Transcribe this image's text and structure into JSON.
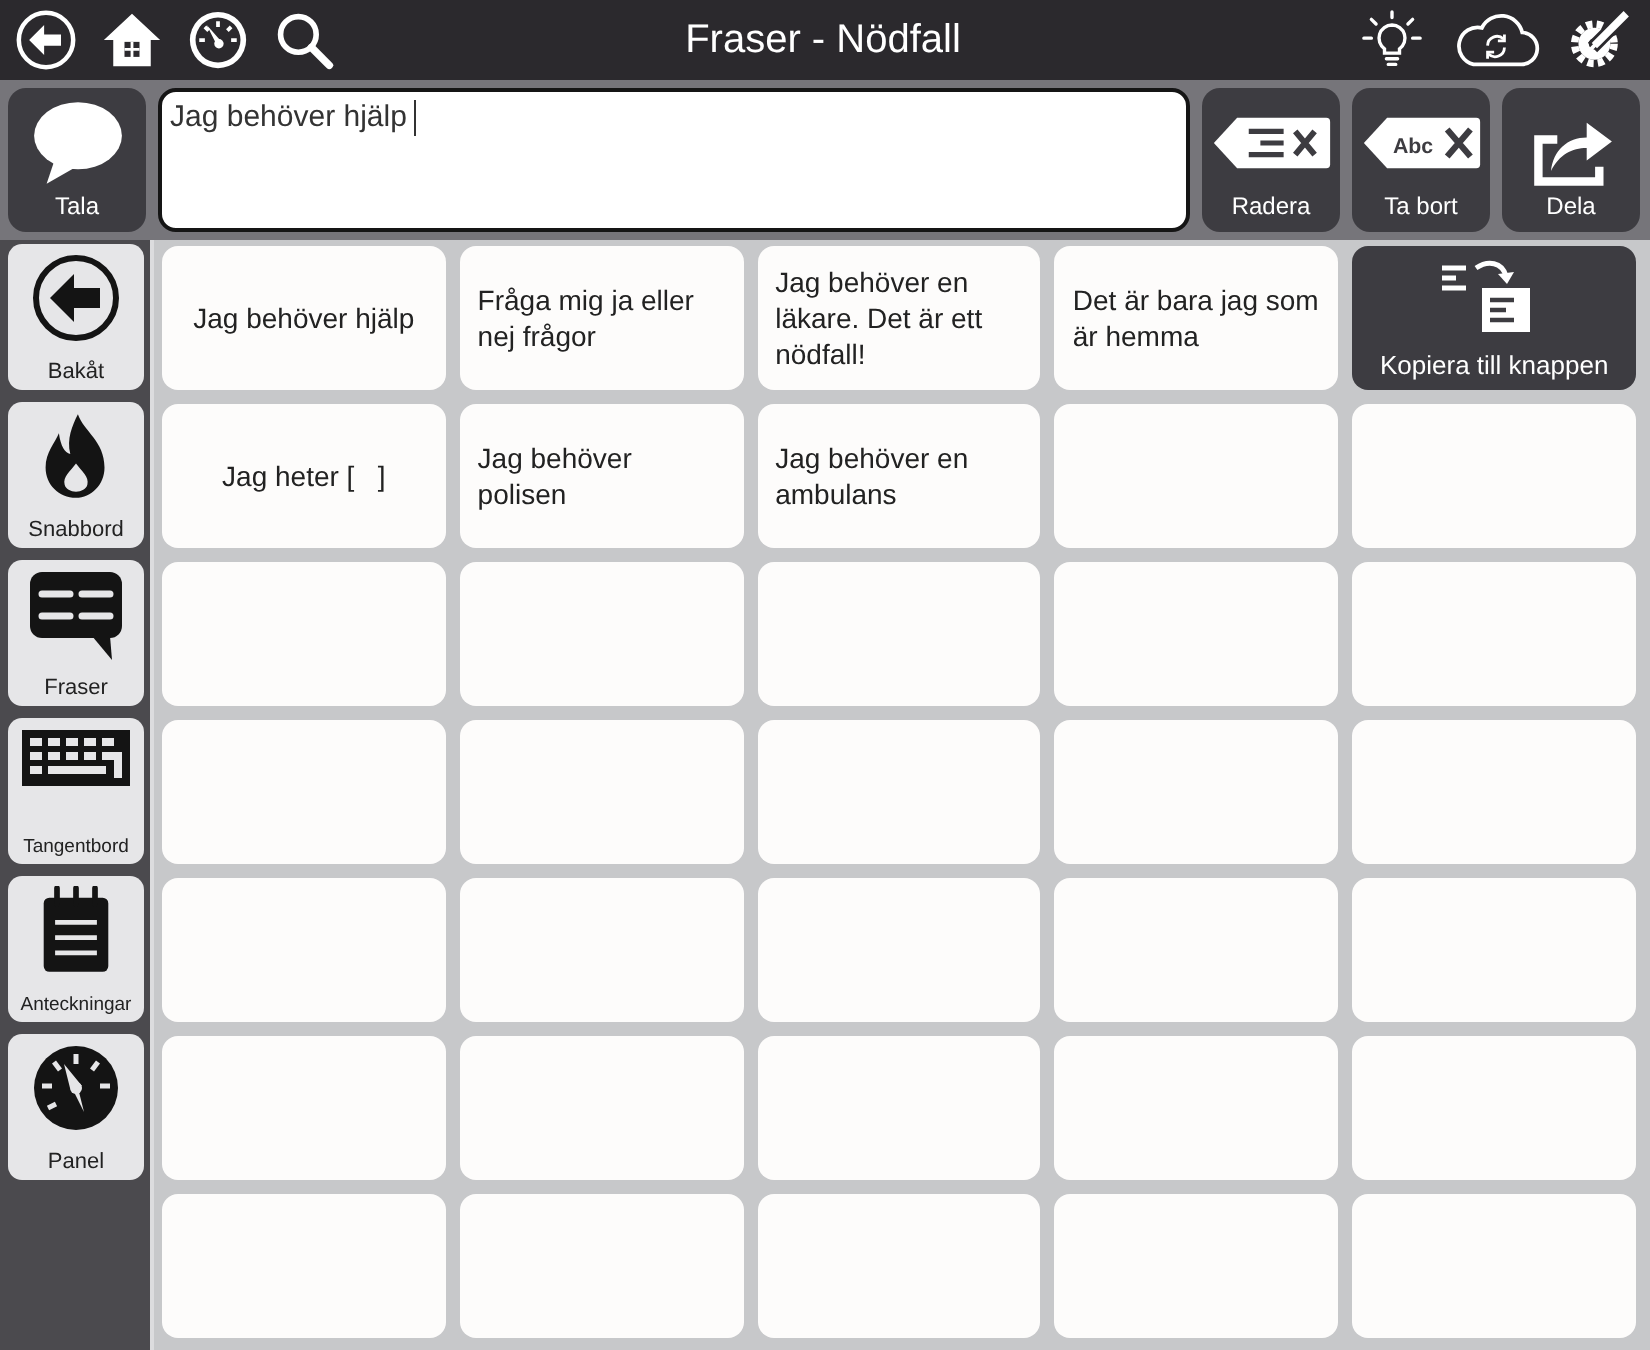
{
  "top_bar": {
    "title": "Fraser - Nödfall"
  },
  "message_bar": {
    "speak": {
      "label": "Tala"
    },
    "message": {
      "value": "Jag behöver hjälp"
    },
    "actions": [
      {
        "kind": "clear",
        "label": "Radera"
      },
      {
        "kind": "delete",
        "label": "Ta bort",
        "icon_text": "Abc"
      },
      {
        "kind": "share",
        "label": "Dela"
      }
    ]
  },
  "sidebar": {
    "items": [
      {
        "kind": "back",
        "label": "Bakåt"
      },
      {
        "kind": "quickboard",
        "label": "Snabbord"
      },
      {
        "kind": "phrases",
        "label": "Fraser"
      },
      {
        "kind": "keyboard",
        "label": "Tangentbord"
      },
      {
        "kind": "notes",
        "label": "Anteckningar"
      },
      {
        "kind": "dashboard",
        "label": "Panel"
      }
    ]
  },
  "grid": {
    "rows": [
      [
        {
          "kind": "phrase",
          "text": "Jag behöver hjälp"
        },
        {
          "kind": "phrase",
          "text": "Fråga mig ja eller nej frågor"
        },
        {
          "kind": "phrase",
          "text": "Jag behöver en läkare. Det är ett nödfall!"
        },
        {
          "kind": "phrase",
          "text": "Det är bara jag som är hemma"
        },
        {
          "kind": "copy",
          "label": "Kopiera till knappen"
        }
      ],
      [
        {
          "kind": "phrase",
          "text": "Jag heter [   ]"
        },
        {
          "kind": "phrase",
          "text": "Jag behöver polisen"
        },
        {
          "kind": "phrase",
          "text": "Jag behöver en ambulans"
        },
        {
          "kind": "empty"
        },
        {
          "kind": "empty"
        }
      ],
      [
        {
          "kind": "empty"
        },
        {
          "kind": "empty"
        },
        {
          "kind": "empty"
        },
        {
          "kind": "empty"
        },
        {
          "kind": "empty"
        }
      ],
      [
        {
          "kind": "empty"
        },
        {
          "kind": "empty"
        },
        {
          "kind": "empty"
        },
        {
          "kind": "empty"
        },
        {
          "kind": "empty"
        }
      ],
      [
        {
          "kind": "empty"
        },
        {
          "kind": "empty"
        },
        {
          "kind": "empty"
        },
        {
          "kind": "empty"
        },
        {
          "kind": "empty"
        }
      ],
      [
        {
          "kind": "empty"
        },
        {
          "kind": "empty"
        },
        {
          "kind": "empty"
        },
        {
          "kind": "empty"
        },
        {
          "kind": "empty"
        }
      ],
      [
        {
          "kind": "empty"
        },
        {
          "kind": "empty"
        },
        {
          "kind": "empty"
        },
        {
          "kind": "empty"
        },
        {
          "kind": "empty"
        }
      ]
    ]
  }
}
